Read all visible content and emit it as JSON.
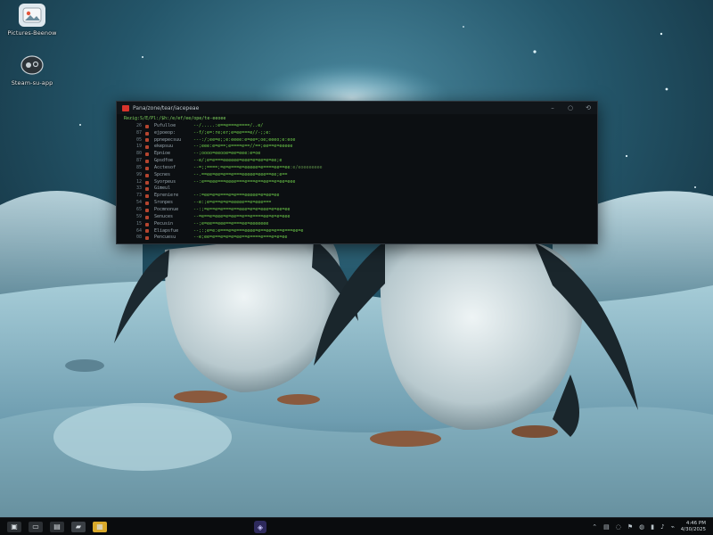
{
  "desktop": {
    "icons": [
      {
        "label": "Pictures-Beenow",
        "icon": "photos-icon"
      },
      {
        "label": "Steam-su-app",
        "icon": "app-icon"
      }
    ]
  },
  "terminal": {
    "title": "Pana/zone/tear/iacepeae",
    "controls": {
      "minimize": "–",
      "restore": "○",
      "close": "⟲"
    },
    "prompt": "Rezig:S/E/Pl:/$h:/e/ef/ee/ope/te-eeoee",
    "rows": [
      {
        "ln": "26",
        "key": "Pufulloe",
        "out": "--/.....:e==e===e====/..e/",
        "tail": ""
      },
      {
        "ln": "87",
        "key": "ejpoeop:",
        "out": "--f/;e=:re;er;e=ee===e//-;;e:",
        "tail": ""
      },
      {
        "ln": "05",
        "key": "ppnepecsuu",
        "out": "---:/;ee=e;;e:eeee:e=ee=;oe;eeeo;e:eoe",
        "tail": ""
      },
      {
        "ln": "19",
        "key": "ekepsuu",
        "out": "--;eee:e=e==;e====e==//==;ee==e=eeeee",
        "tail": ""
      },
      {
        "ln": "80",
        "key": "Epnioe",
        "out": "--;oooo=eeooe=ee=eee:e=oe",
        "tail": ""
      },
      {
        "ln": "87",
        "key": "Gpsdfoe",
        "out": "--e/;e=e===eeeeee=eee=e=ee=e=ee;e",
        "tail": ""
      },
      {
        "ln": "85",
        "key": "Acctesof",
        "out": "--=;;====;=e=e===e=eeeee=e====ee==ee",
        "tail": ":e/eoeeeeeee"
      },
      {
        "ln": "99",
        "key": "Spcnes",
        "out": "--.==ee=ee=e==e===eeeee=eee==ee;e==",
        "tail": ""
      },
      {
        "ln": "12",
        "key": "Syorpeus",
        "out": "--:e==eee===eeee===e===e==ee==e=ee=eee",
        "tail": ""
      },
      {
        "ln": "33",
        "key": "Gimeul",
        "out": "",
        "tail": ""
      },
      {
        "ln": "73",
        "key": "Epreniere",
        "out": "--:=ee=e=e===e=e===eeeee=e=ee=ee",
        "tail": ""
      },
      {
        "ln": "54",
        "key": "Sronpes",
        "out": "--e:;e=e==e=e=eeeee==e=eee===",
        "tail": ""
      },
      {
        "ln": "65",
        "key": "Pocmnonue",
        "out": "--:;=e==e=e===e==eee=e=e=eee=e=ee=ee",
        "tail": ""
      },
      {
        "ln": "59",
        "key": "Senuces",
        "out": "--=e==e=eee=e=ee==e==e====ee=e=e=eee",
        "tail": ""
      },
      {
        "ln": "15",
        "key": "Pecusin",
        "out": "--;e=ee==eee==e===ee=eeeeeee",
        "tail": ""
      },
      {
        "ln": "64",
        "key": "Eliapsfue",
        "out": "--;:;e=e:e===e=e===eeee=e==ee=e==e===ee=e",
        "tail": ""
      },
      {
        "ln": "08",
        "key": "Pencuesu",
        "out": "--e;ee=e==e=e=e=ee==e====e===e=e=ee",
        "tail": ""
      }
    ]
  },
  "taskbar": {
    "left_buttons": [
      {
        "name": "start-icon",
        "glyph": "▣",
        "color": "#2b2f33"
      },
      {
        "name": "task-view-icon",
        "glyph": "▭",
        "color": "#2b2f33"
      },
      {
        "name": "terminal-icon",
        "glyph": "▤",
        "color": "#2b2f33"
      },
      {
        "name": "folder-icon",
        "glyph": "▰",
        "color": "#3a3f44"
      },
      {
        "name": "notes-icon",
        "glyph": "▦",
        "color": "#d9a92a"
      }
    ],
    "center_app_glyph": "◈",
    "tray_icons": [
      "⌃",
      "▤",
      "◌",
      "⚑",
      "◍",
      "▮",
      "♪",
      "⌁"
    ],
    "clock_time": "4:46 PM",
    "clock_date": "4/30/2025"
  },
  "colors": {
    "accent": "#6fcf4a",
    "terminal_bg": "#0c0f12",
    "taskbar_bg": "#0a0c0e",
    "close_red": "#d8342c"
  }
}
